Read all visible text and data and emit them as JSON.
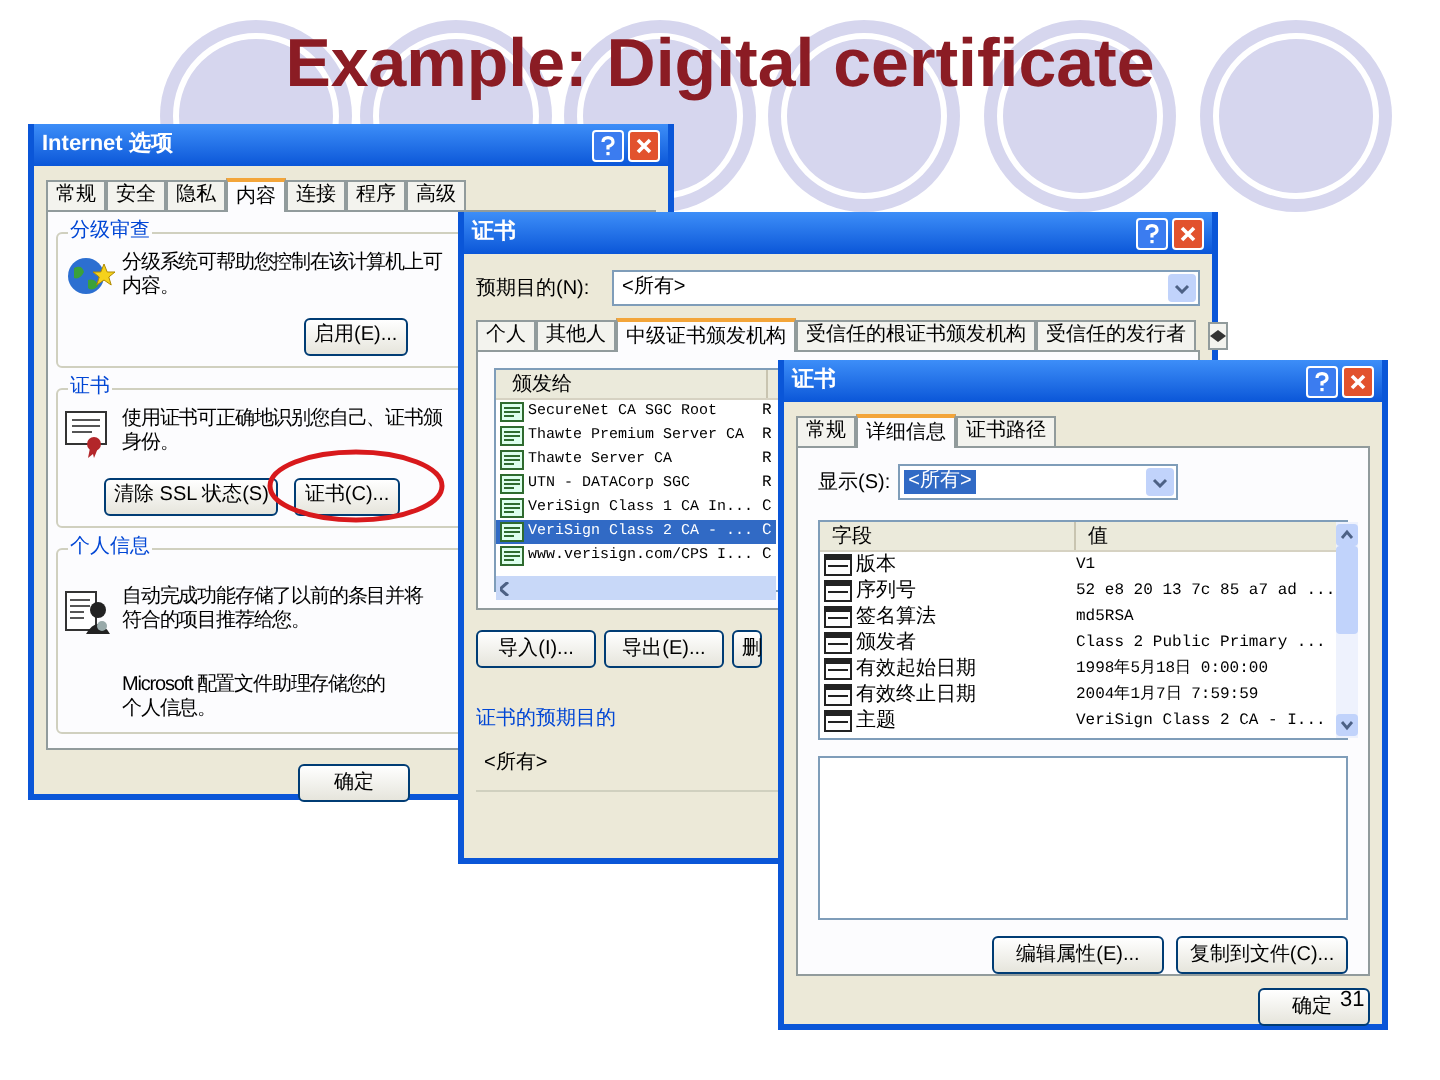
{
  "slide": {
    "title": "Example: Digital certificate",
    "page_number": "31"
  },
  "internet_options": {
    "title": "Internet 选项",
    "tabs": [
      {
        "label": "常规",
        "selected": false
      },
      {
        "label": "安全",
        "selected": false
      },
      {
        "label": "隐私",
        "selected": false
      },
      {
        "label": "内容",
        "selected": true
      },
      {
        "label": "连接",
        "selected": false
      },
      {
        "label": "程序",
        "selected": false
      },
      {
        "label": "高级",
        "selected": false
      }
    ],
    "groups": [
      {
        "kind": "ratings",
        "heading": "分级审查",
        "items": [
          {
            "lines": [
              "分级系统可帮助您控制在该计算机上可",
              "内容。"
            ],
            "buttons": [
              {
                "label": "启用(E)...",
                "circled": false
              }
            ]
          }
        ]
      },
      {
        "kind": "certificates",
        "heading": "证书",
        "items": [
          {
            "lines": [
              "使用证书可正确地识别您自己、证书颁",
              "身份。"
            ],
            "buttons": [
              {
                "label": "清除 SSL 状态(S)",
                "circled": false
              },
              {
                "label": "证书(C)...",
                "circled": true
              }
            ]
          }
        ]
      },
      {
        "kind": "personal",
        "heading": "个人信息",
        "items": [
          {
            "lines": [
              "自动完成功能存储了以前的条目并将",
              "符合的项目推荐给您。"
            ]
          },
          {
            "lines": [
              "Microsoft 配置文件助理存储您的",
              "个人信息。"
            ]
          }
        ]
      }
    ],
    "buttons": [
      "确定"
    ]
  },
  "certificates": {
    "title": "证书",
    "purpose_label": "预期目的(N):",
    "purpose_value": "<所有>",
    "tabs": [
      {
        "label": "个人",
        "selected": false
      },
      {
        "label": "其他人",
        "selected": false
      },
      {
        "label": "中级证书颁发机构",
        "selected": true
      },
      {
        "label": "受信任的根证书颁发机构",
        "selected": false
      },
      {
        "label": "受信任的发行者",
        "selected": false
      }
    ],
    "columns": [
      "颁发给"
    ],
    "rows": [
      {
        "issued_to": "SecureNet CA SGC Root",
        "column_2": "R",
        "selected": false
      },
      {
        "issued_to": "Thawte Premium Server CA",
        "column_2": "R",
        "selected": false
      },
      {
        "issued_to": "Thawte Server CA",
        "column_2": "R",
        "selected": false
      },
      {
        "issued_to": "UTN - DATACorp SGC",
        "column_2": "R",
        "selected": false
      },
      {
        "issued_to": "VeriSign Class 1 CA In...",
        "column_2": "C",
        "selected": false
      },
      {
        "issued_to": "VeriSign Class 2 CA - ...",
        "column_2": "C",
        "selected": true
      },
      {
        "issued_to": "www.verisign.com/CPS I...",
        "column_2": "C",
        "selected": false
      }
    ],
    "buttons": [
      "导入(I)...",
      "导出(E)...",
      "删"
    ],
    "purposes_heading": "证书的预期目的",
    "purposes_value": "<所有>"
  },
  "certificate": {
    "title": "证书",
    "tabs": [
      {
        "label": "常规",
        "selected": false
      },
      {
        "label": "详细信息",
        "selected": true
      },
      {
        "label": "证书路径",
        "selected": false
      }
    ],
    "show_label": "显示(S):",
    "show_value": "<所有>",
    "show_highlighted": true,
    "columns": [
      "字段",
      "值"
    ],
    "fields": [
      {
        "field": "版本",
        "value": "V1"
      },
      {
        "field": "序列号",
        "value": "52 e8 20 13 7c 85 a7 ad ..."
      },
      {
        "field": "签名算法",
        "value": "md5RSA"
      },
      {
        "field": "颁发者",
        "value": "Class 2 Public Primary ..."
      },
      {
        "field": "有效起始日期",
        "value": "1998年5月18日 0:00:00"
      },
      {
        "field": "有效终止日期",
        "value": "2004年1月7日 7:59:59"
      },
      {
        "field": "主题",
        "value": "VeriSign Class 2 CA - I..."
      }
    ],
    "buttons": [
      "编辑属性(E)...",
      "复制到文件(C)..."
    ],
    "ok": "确定"
  }
}
